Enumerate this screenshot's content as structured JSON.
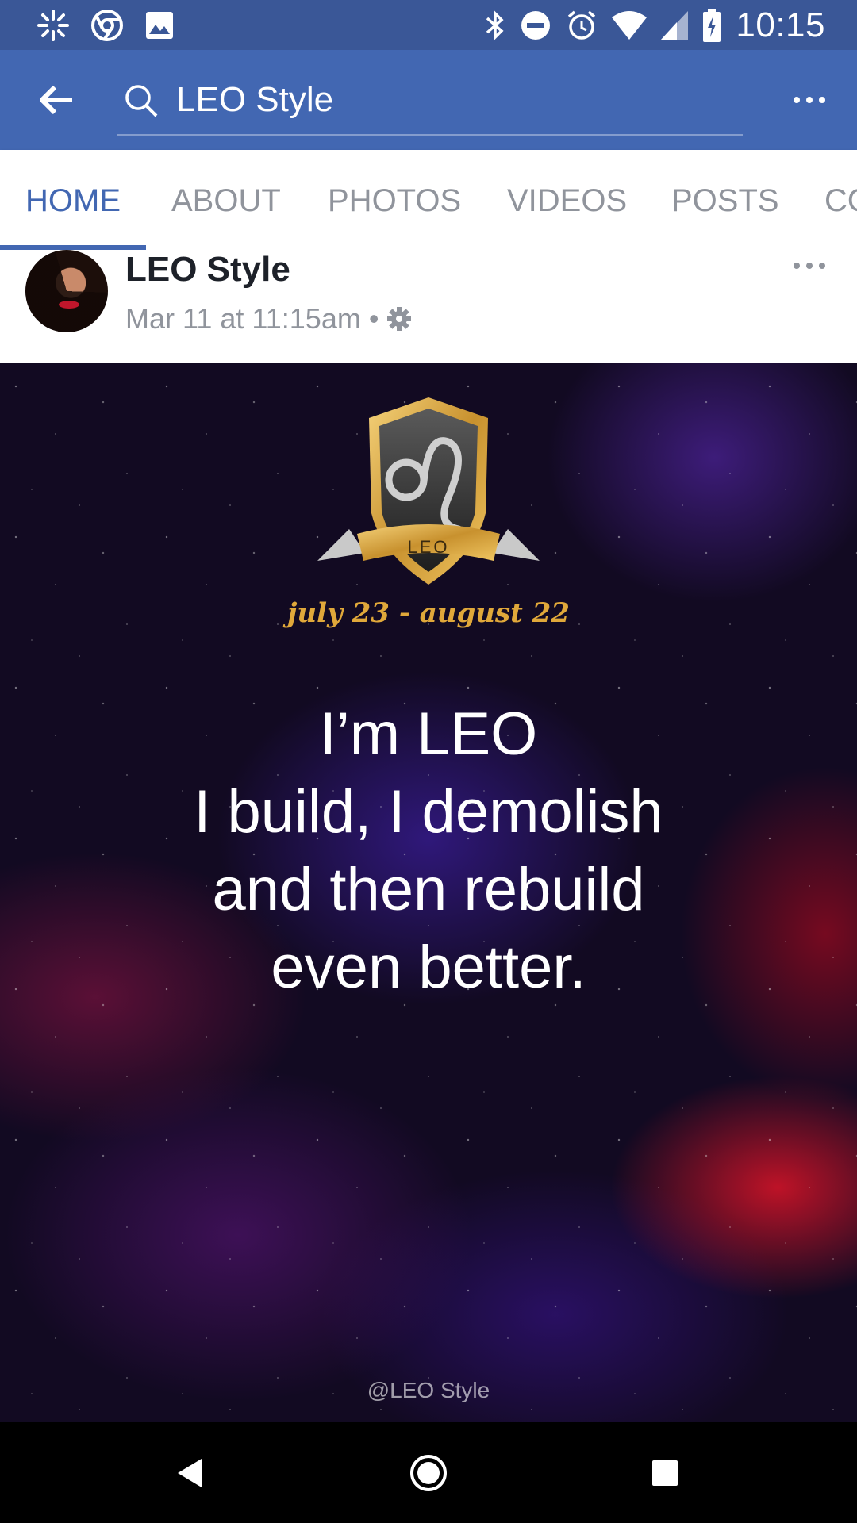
{
  "status_bar": {
    "time": "10:15",
    "left_icons": [
      "pinwheel-icon",
      "chrome-icon",
      "image-icon"
    ],
    "right_icons": [
      "bluetooth-icon",
      "do-not-disturb-icon",
      "alarm-icon",
      "wifi-icon",
      "signal-icon",
      "battery-icon"
    ]
  },
  "app_bar": {
    "search_text": "LEO Style"
  },
  "tabs": [
    {
      "label": "HOME",
      "active": true
    },
    {
      "label": "ABOUT",
      "active": false
    },
    {
      "label": "PHOTOS",
      "active": false
    },
    {
      "label": "VIDEOS",
      "active": false
    },
    {
      "label": "POSTS",
      "active": false
    },
    {
      "label": "CO",
      "active": false
    }
  ],
  "post": {
    "author": "LEO Style",
    "timestamp": "Mar 11 at 11:15am",
    "separator": "•",
    "image": {
      "badge_label": "LEO",
      "dates": "july 23 - august 22",
      "quote_lines": [
        "I’m LEO",
        "I build, I demolish",
        "and then rebuild",
        "even better."
      ],
      "credit": "@LEO Style"
    }
  },
  "colors": {
    "status_bar": "#3a5797",
    "app_bar": "#4267b2",
    "tab_active": "#4267b2",
    "tab_inactive": "#90949c",
    "date_gold": "#e0a83a"
  }
}
